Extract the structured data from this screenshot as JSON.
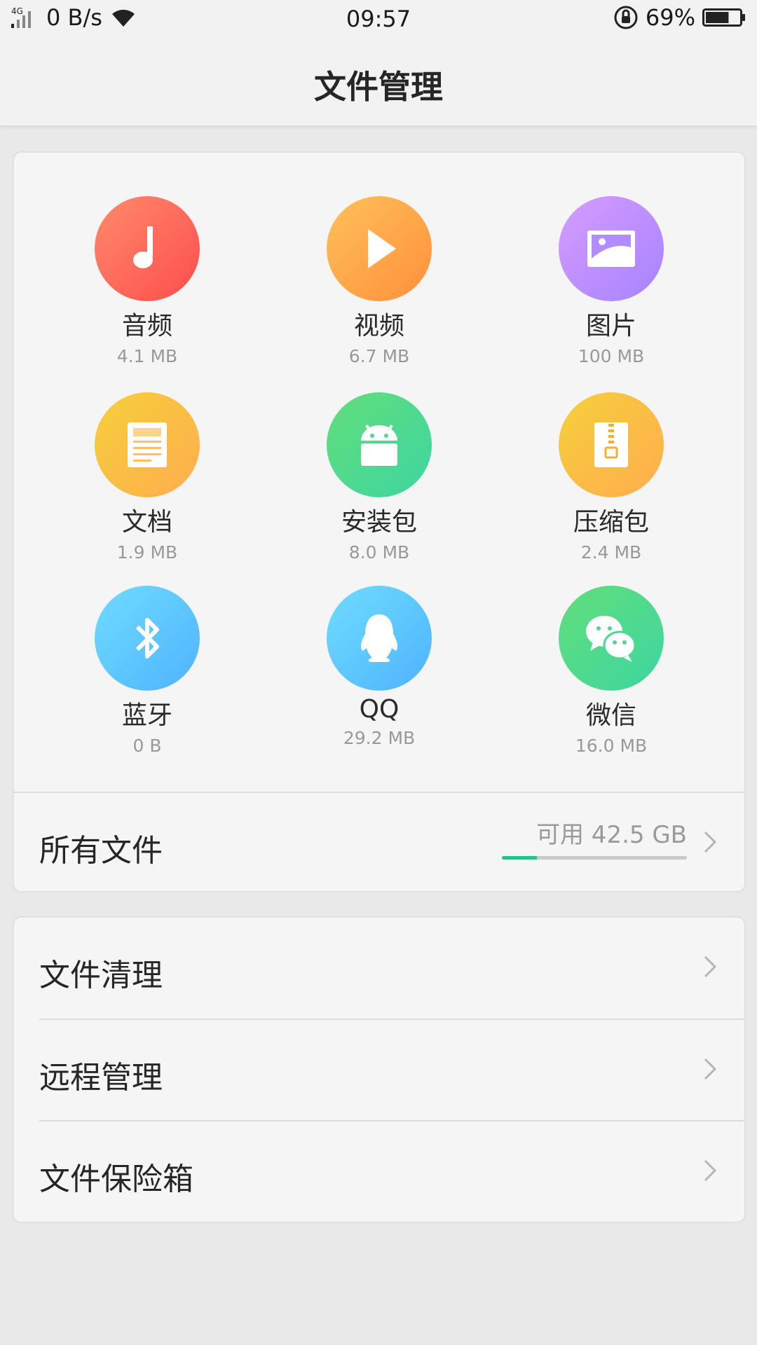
{
  "status_bar": {
    "network": "4G",
    "net_speed": "0 B/s",
    "time": "09:57",
    "battery_percent": "69%",
    "battery_level": 0.69
  },
  "app_bar": {
    "title": "文件管理"
  },
  "categories": [
    {
      "label": "音频",
      "size": "4.1 MB",
      "icon": "music-note-icon",
      "colors": [
        "#ff8a6b",
        "#ff4d4d"
      ]
    },
    {
      "label": "视频",
      "size": "6.7 MB",
      "icon": "play-icon",
      "colors": [
        "#ffc15a",
        "#ff8f3c"
      ]
    },
    {
      "label": "图片",
      "size": "100 MB",
      "icon": "image-icon",
      "colors": [
        "#d69cff",
        "#a683ff"
      ]
    },
    {
      "label": "文档",
      "size": "1.9 MB",
      "icon": "document-icon",
      "colors": [
        "#f6cf3a",
        "#ffad4f"
      ]
    },
    {
      "label": "安装包",
      "size": "8.0 MB",
      "icon": "android-icon",
      "colors": [
        "#63de7a",
        "#3dd5a3"
      ]
    },
    {
      "label": "压缩包",
      "size": "2.4 MB",
      "icon": "zip-icon",
      "colors": [
        "#f6cf3a",
        "#ffad4f"
      ]
    },
    {
      "label": "蓝牙",
      "size": "0 B",
      "icon": "bluetooth-icon",
      "colors": [
        "#6fdcff",
        "#4fb3ff"
      ]
    },
    {
      "label": "QQ",
      "size": "29.2 MB",
      "icon": "qq-penguin-icon",
      "colors": [
        "#6fdcff",
        "#4fb3ff"
      ]
    },
    {
      "label": "微信",
      "size": "16.0 MB",
      "icon": "wechat-icon",
      "colors": [
        "#63de7a",
        "#3dd5a3"
      ]
    }
  ],
  "all_files": {
    "label": "所有文件",
    "available": "可用 42.5 GB",
    "used_fraction": 0.19,
    "used_color": "#2fbf8a"
  },
  "tools": [
    {
      "label": "文件清理"
    },
    {
      "label": "远程管理"
    },
    {
      "label": "文件保险箱"
    }
  ]
}
